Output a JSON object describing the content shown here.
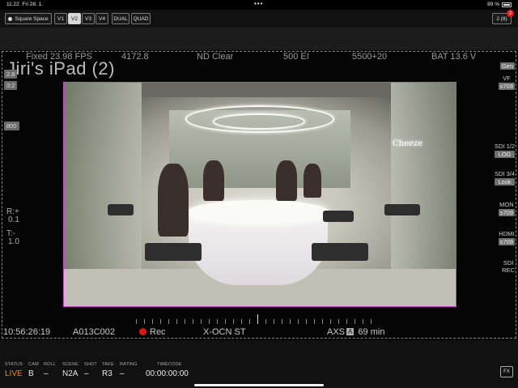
{
  "status_bar": {
    "time": "11:22",
    "date": "Fri 28. 1.",
    "dots": "•••",
    "battery": "89 %"
  },
  "toolbar": {
    "camera_label": "Square Space",
    "views": [
      "V1",
      "V2",
      "V3",
      "V4"
    ],
    "active_view": "V2",
    "dual_label": "DUAL",
    "quad_label": "QUAD",
    "devices_label": "2 (8)",
    "devices_badge": "2"
  },
  "monitor": {
    "device_title": "Jiri's iPad (2)",
    "fps": "Fixed 23.98 FPS",
    "shutter": "4172.8",
    "nd": "ND Clear",
    "ei": "500 EI",
    "wb": "5500+20",
    "battery": "BAT 13.6 V",
    "left_aspect_top": "2.8",
    "left_aspect": "3:2",
    "left_iso": "800",
    "left_r_label": "R:+",
    "left_r_value": "0.1",
    "left_t_label": "T:-",
    "left_t_value": "1.0",
    "right_gen": "Gen",
    "right_vf_label": "VF",
    "right_vf_value": "s709",
    "right_sdi12_label": "SDI 1/2",
    "right_sdi12_value": "LOG",
    "right_sdi34_label": "SDI 3/4",
    "right_sdi34_value": "Look",
    "right_mon_label": "MON",
    "right_mon_value": "s709",
    "right_hdmi_label": "HDMI",
    "right_hdmi_value": "s709",
    "right_sdi_rec_label": "SDI",
    "right_sdi_rec_value": "REC",
    "timecode": "10:56:26:19",
    "clip": "A013C002",
    "rec_label": "Rec",
    "codec": "X-OCN ST",
    "axs_label": "AXS",
    "axs_badge": "A",
    "remaining": "69 min",
    "signage": "Cheeze"
  },
  "bottom": {
    "status_label": "STATUS",
    "status_value": "LIVE",
    "cam_label": "CAM",
    "cam_value": "B",
    "roll_label": "ROLL",
    "roll_value": "–",
    "scene_label": "SCENE",
    "scene_value": "N2A",
    "shot_label": "SHOT",
    "shot_value": "–",
    "take_label": "TAKE",
    "take_value": "R3",
    "rating_label": "RATING",
    "rating_value": "–",
    "timecode_label": "TIMECODE",
    "timecode_value": "00:00:00:00",
    "fx_label": "FX"
  },
  "colors": {
    "live": "#f08a10",
    "rec": "#d81818",
    "frame_guide": "#d040d0",
    "badge": "#e02020"
  }
}
